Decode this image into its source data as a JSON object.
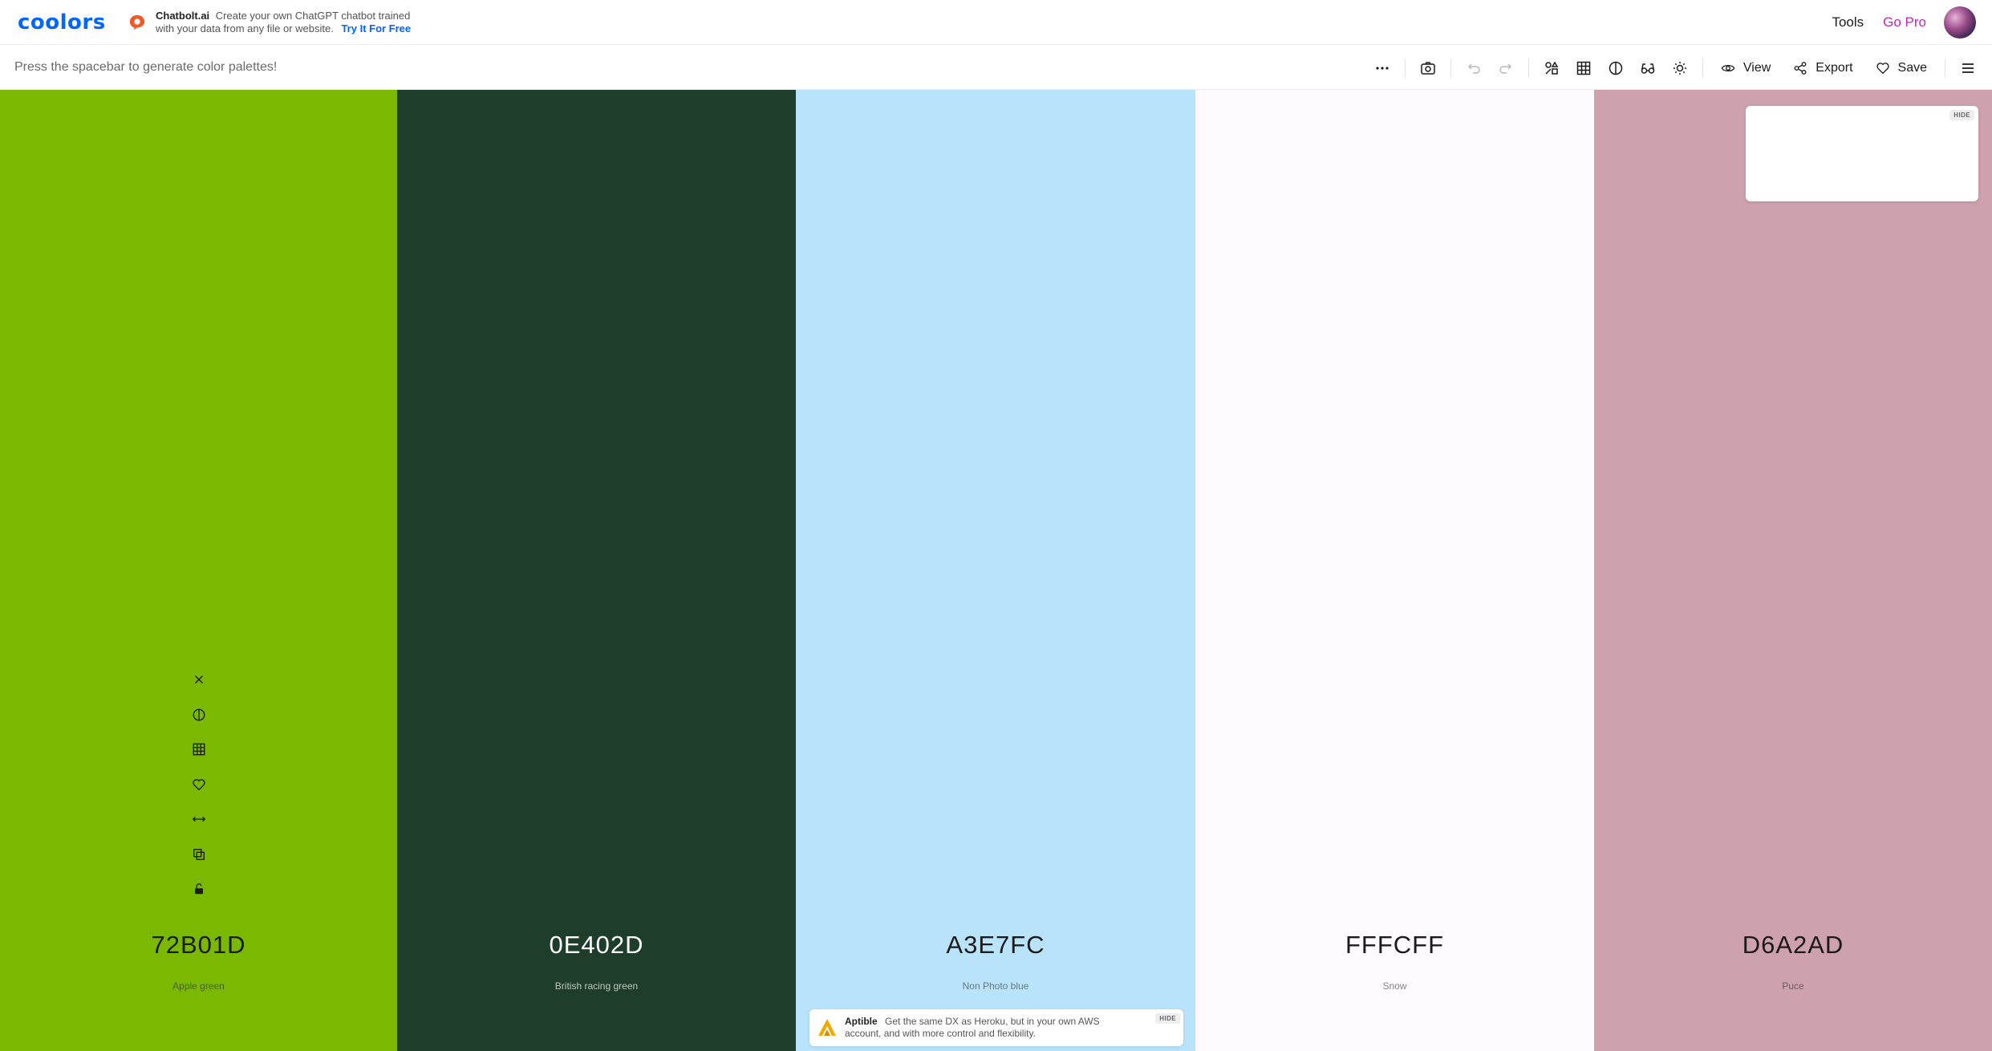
{
  "app": {
    "logo_text": "coolors"
  },
  "top_ad": {
    "brand": "Chatbolt.ai",
    "text": "Create your own ChatGPT chatbot trained with your data from any file or website.",
    "cta": "Try It For Free"
  },
  "nav": {
    "tools": "Tools",
    "go_pro": "Go Pro"
  },
  "toolbar": {
    "hint": "Press the spacebar to generate color palettes!",
    "view_label": "View",
    "export_label": "Export",
    "save_label": "Save"
  },
  "palette": {
    "colors": [
      {
        "hex": "72B01D",
        "name": "Apple green",
        "bg": "#7ab802",
        "dark": false
      },
      {
        "hex": "0E402D",
        "name": "British racing green",
        "bg": "#1e3d2a",
        "dark": true
      },
      {
        "hex": "A3E7FC",
        "name": "Non Photo blue",
        "bg": "#b9e3fb",
        "dark": false
      },
      {
        "hex": "FFFCFF",
        "name": "Snow",
        "bg": "#fdfbff",
        "dark": false
      },
      {
        "hex": "D6A2AD",
        "name": "Puce",
        "bg": "#cda1ad",
        "dark": false
      }
    ]
  },
  "floating_ad": {
    "hide_label": "HIDE"
  },
  "bottom_ad": {
    "brand": "Aptible",
    "text": "Get the same DX as Heroku, but in your own AWS account, and with more control and flexibility.",
    "hide_label": "HIDE"
  },
  "icons": {
    "toolbar": [
      "more-icon",
      "camera-icon",
      "undo-icon",
      "redo-icon",
      "shapes-icon",
      "grid-icon",
      "contrast-icon",
      "glasses-icon",
      "sun-icon",
      "eye-icon",
      "share-icon",
      "heart-icon",
      "menu-icon"
    ],
    "swatch_tools": [
      "close-icon",
      "contrast-icon",
      "grid-icon",
      "heart-icon",
      "drag-arrows-icon",
      "copy-icon",
      "lock-open-icon"
    ]
  }
}
